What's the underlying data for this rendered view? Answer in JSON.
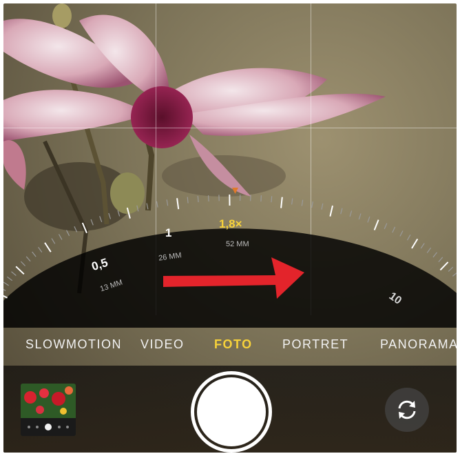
{
  "zoom_dial": {
    "ticks": [
      {
        "value": "0,5",
        "focal": "13 MM"
      },
      {
        "value": "1",
        "focal": "26 MM"
      },
      {
        "value": "1,8×",
        "focal": "52 MM"
      },
      {
        "value": "10",
        "focal": ""
      }
    ],
    "current_zoom": "1,8×",
    "accent_color": "#f7d23a",
    "indicator_color": "#e07a2a"
  },
  "annotation": {
    "arrow_color": "#e3242b"
  },
  "modes": [
    {
      "label": "SLOWMOTION",
      "active": false
    },
    {
      "label": "VIDEO",
      "active": false
    },
    {
      "label": "FOTO",
      "active": true
    },
    {
      "label": "PORTRET",
      "active": false
    },
    {
      "label": "PANORAMA",
      "active": false
    }
  ],
  "controls": {
    "thumbnail_icon": "photo-thumbnail",
    "shutter_icon": "shutter-button",
    "flip_icon": "camera-flip-icon"
  }
}
